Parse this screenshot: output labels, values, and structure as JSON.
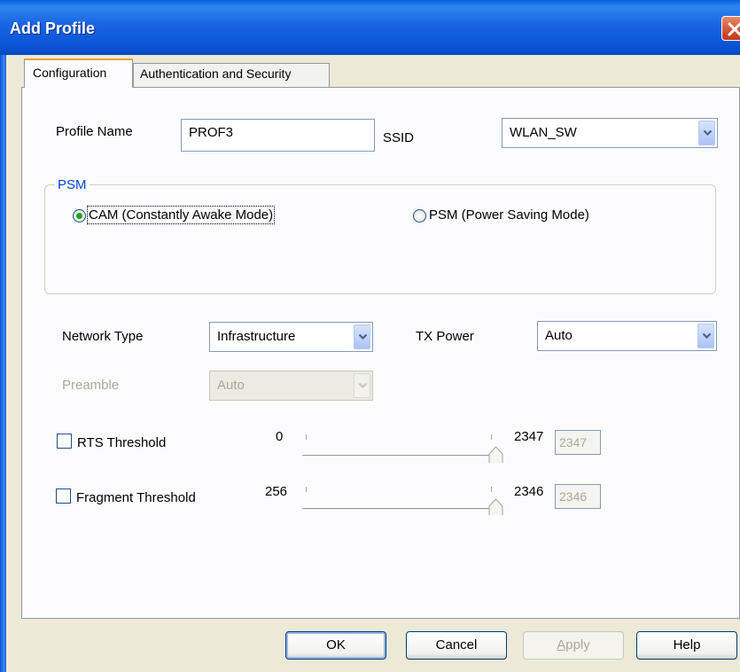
{
  "window": {
    "title": "Add Profile"
  },
  "tabs": [
    {
      "label": "Configuration",
      "active": true
    },
    {
      "label": "Authentication and Security",
      "active": false
    }
  ],
  "profile": {
    "label": "Profile Name",
    "value": "PROF3"
  },
  "ssid": {
    "label": "SSID",
    "value": "WLAN_SW"
  },
  "psm": {
    "legend": "PSM",
    "options": [
      {
        "label": "CAM (Constantly Awake Mode)",
        "selected": true
      },
      {
        "label": "PSM (Power Saving Mode)",
        "selected": false
      }
    ]
  },
  "network_type": {
    "label": "Network Type",
    "value": "Infrastructure"
  },
  "tx_power": {
    "label": "TX Power",
    "value": "Auto"
  },
  "preamble": {
    "label": "Preamble",
    "value": "Auto",
    "enabled": false
  },
  "rts": {
    "label": "RTS Threshold",
    "checked": false,
    "min": "0",
    "max": "2347",
    "value": "2347"
  },
  "fragment": {
    "label": "Fragment Threshold",
    "checked": false,
    "min": "256",
    "max": "2346",
    "value": "2346"
  },
  "buttons": {
    "ok": "OK",
    "cancel": "Cancel",
    "apply_prefix": "",
    "apply_hotkey": "A",
    "apply_rest": "pply",
    "help": "Help"
  },
  "colors": {
    "titlebar": "#0b55d8",
    "group_legend": "#0046d5",
    "radio_dot": "#21a121",
    "tab_highlight": "#e6a33a"
  }
}
